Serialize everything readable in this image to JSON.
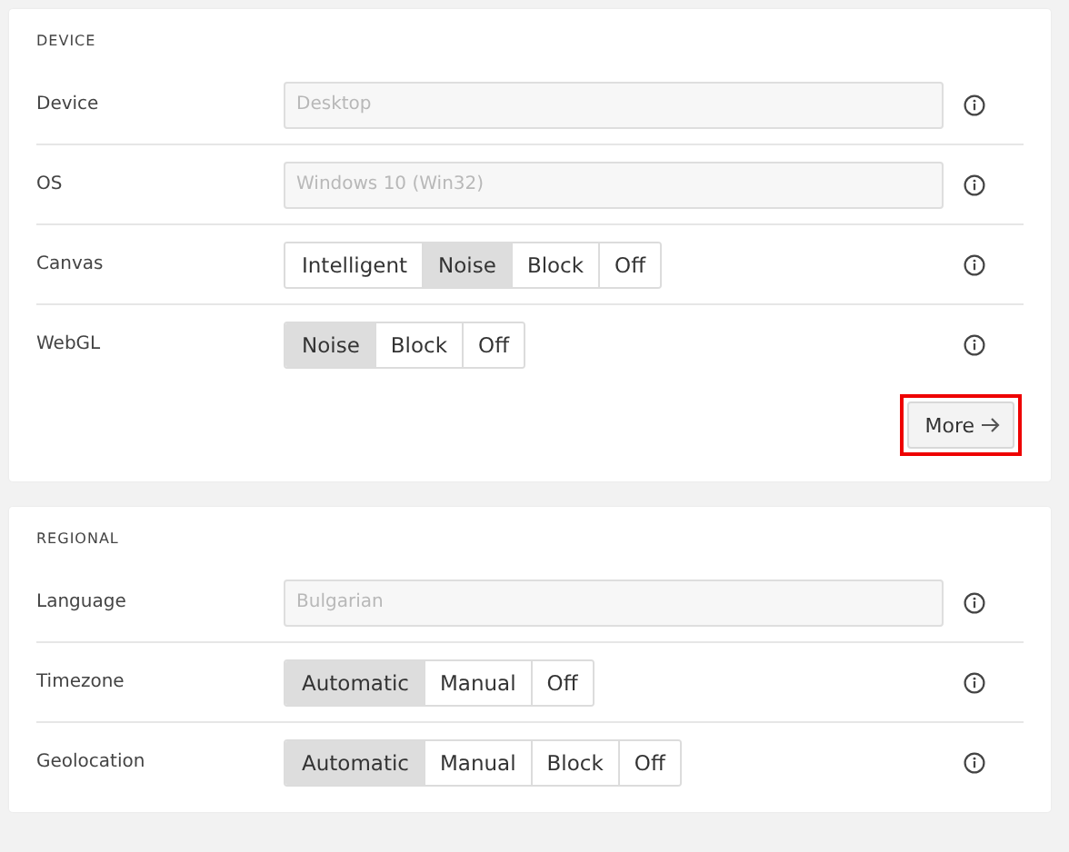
{
  "sections": [
    {
      "title": "DEVICE",
      "rows": [
        {
          "kind": "field",
          "label": "Device",
          "value": "Desktop",
          "disabled": true
        },
        {
          "kind": "field",
          "label": "OS",
          "value": "Windows 10 (Win32)",
          "disabled": true
        },
        {
          "kind": "segmented",
          "label": "Canvas",
          "options": [
            {
              "label": "Intelligent",
              "selected": false
            },
            {
              "label": "Noise",
              "selected": true
            },
            {
              "label": "Block",
              "selected": false
            },
            {
              "label": "Off",
              "selected": false
            }
          ]
        },
        {
          "kind": "segmented",
          "label": "WebGL",
          "options": [
            {
              "label": "Noise",
              "selected": true
            },
            {
              "label": "Block",
              "selected": false
            },
            {
              "label": "Off",
              "selected": false
            }
          ]
        }
      ],
      "more_button": {
        "label": "More",
        "highlighted": true
      }
    },
    {
      "title": "REGIONAL",
      "rows": [
        {
          "kind": "field",
          "label": "Language",
          "value": "Bulgarian",
          "disabled": true
        },
        {
          "kind": "segmented",
          "label": "Timezone",
          "options": [
            {
              "label": "Automatic",
              "selected": true
            },
            {
              "label": "Manual",
              "selected": false
            },
            {
              "label": "Off",
              "selected": false
            }
          ]
        },
        {
          "kind": "segmented",
          "label": "Geolocation",
          "options": [
            {
              "label": "Automatic",
              "selected": true
            },
            {
              "label": "Manual",
              "selected": false
            },
            {
              "label": "Block",
              "selected": false
            },
            {
              "label": "Off",
              "selected": false
            }
          ]
        }
      ]
    }
  ]
}
